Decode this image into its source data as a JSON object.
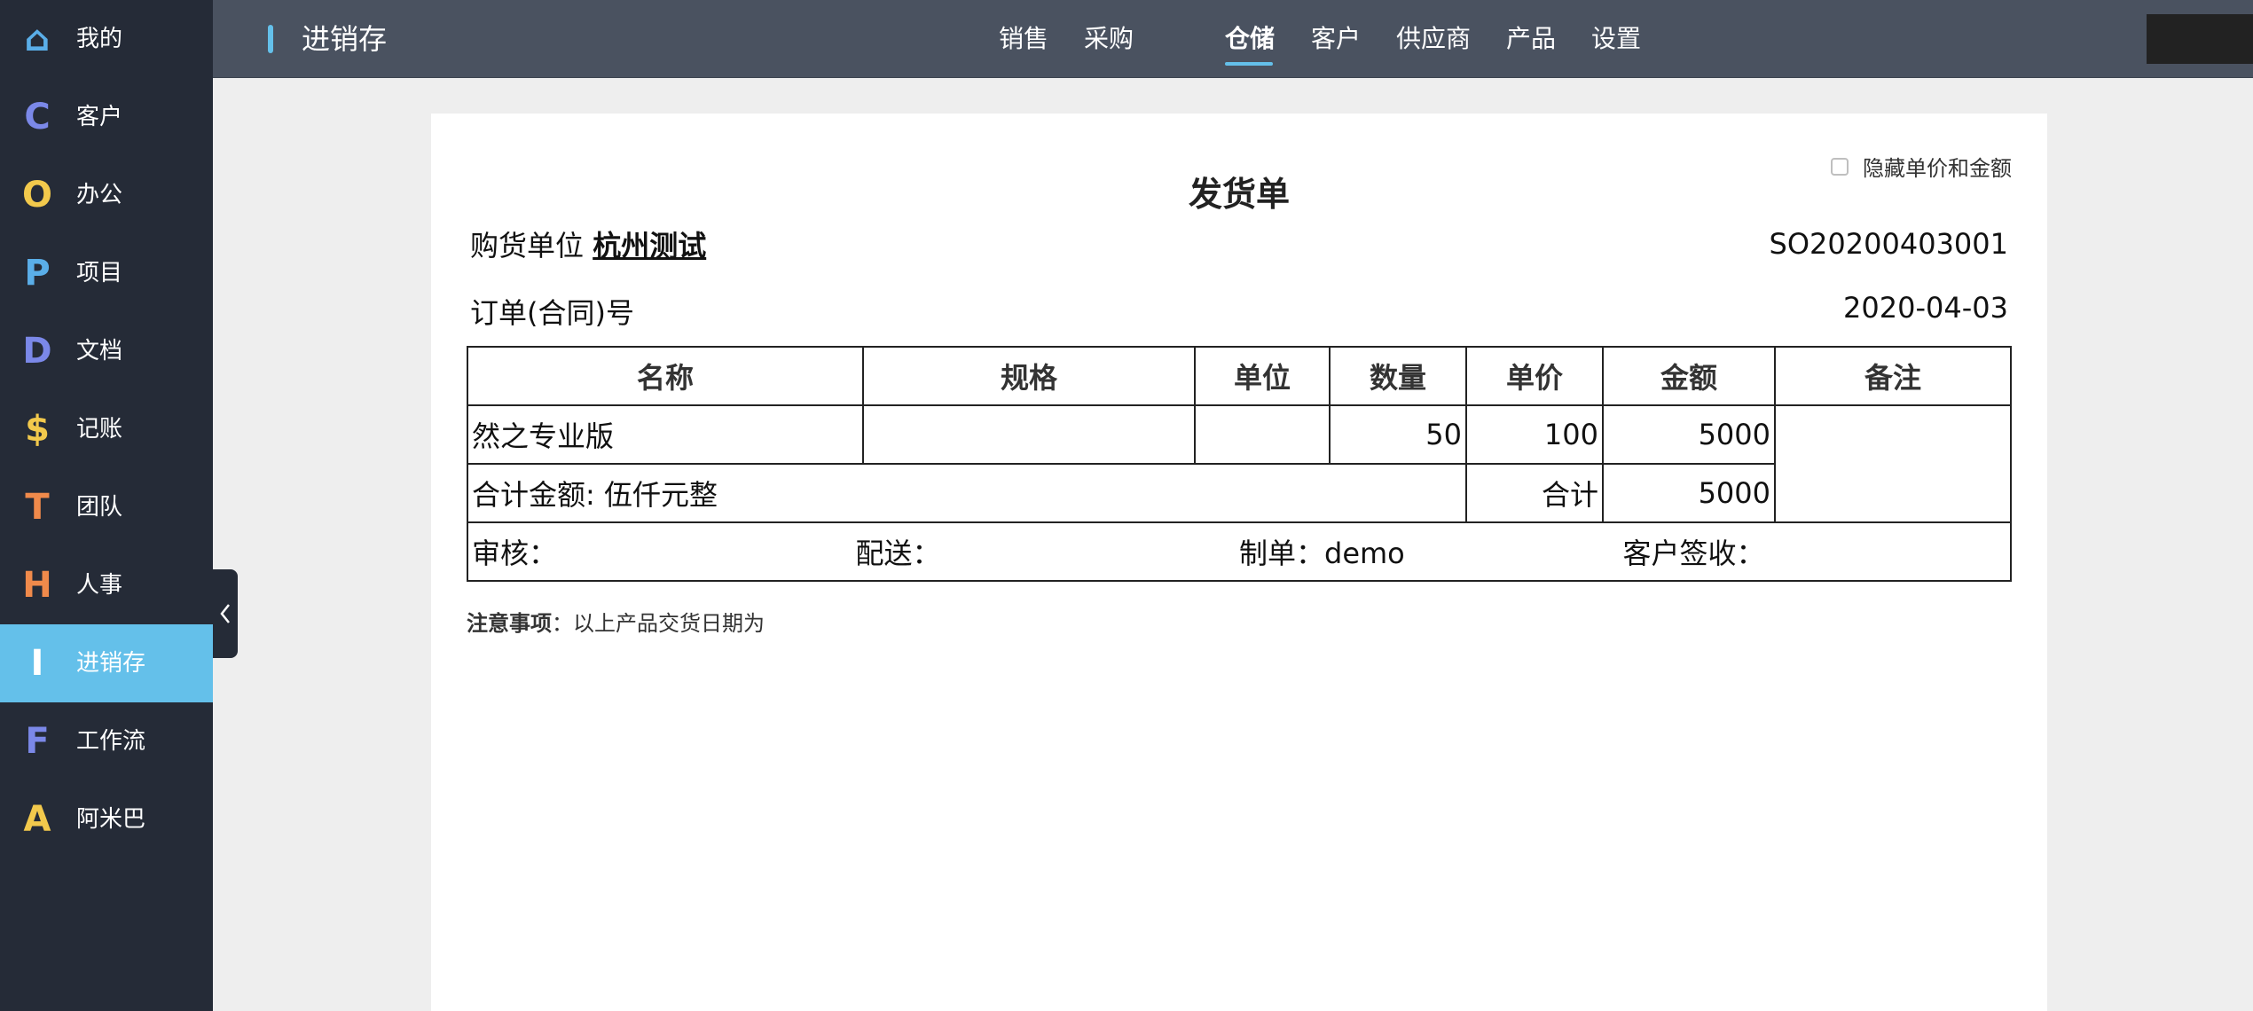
{
  "sidebar": {
    "items": [
      {
        "icon": "home-icon",
        "glyph": "⌂",
        "color": "#5aaee8",
        "label": "我的",
        "active": false
      },
      {
        "icon": "letter-c-icon",
        "glyph": "C",
        "color": "#7b88e8",
        "label": "客户",
        "active": false
      },
      {
        "icon": "letter-o-icon",
        "glyph": "O",
        "color": "#f2c94c",
        "label": "办公",
        "active": false
      },
      {
        "icon": "letter-p-icon",
        "glyph": "P",
        "color": "#5aaee8",
        "label": "项目",
        "active": false
      },
      {
        "icon": "letter-d-icon",
        "glyph": "D",
        "color": "#7b88e8",
        "label": "文档",
        "active": false
      },
      {
        "icon": "dollar-icon",
        "glyph": "$",
        "color": "#f2c94c",
        "label": "记账",
        "active": false
      },
      {
        "icon": "letter-t-icon",
        "glyph": "T",
        "color": "#f08a4b",
        "label": "团队",
        "active": false
      },
      {
        "icon": "letter-h-icon",
        "glyph": "H",
        "color": "#f08a4b",
        "label": "人事",
        "active": false
      },
      {
        "icon": "letter-i-icon",
        "glyph": "I",
        "color": "#ffffff",
        "label": "进销存",
        "active": true
      },
      {
        "icon": "letter-f-icon",
        "glyph": "F",
        "color": "#7b88e8",
        "label": "工作流",
        "active": false
      },
      {
        "icon": "letter-a-icon",
        "glyph": "A",
        "color": "#f2c94c",
        "label": "阿米巴",
        "active": false
      }
    ]
  },
  "header": {
    "app_title": "进销存",
    "tabs": [
      {
        "label": "销售",
        "active": false
      },
      {
        "label": "采购",
        "active": false
      },
      {
        "label": "仓储",
        "active": true
      },
      {
        "label": "客户",
        "active": false
      },
      {
        "label": "供应商",
        "active": false
      },
      {
        "label": "产品",
        "active": false
      },
      {
        "label": "设置",
        "active": false
      }
    ],
    "accent_color": "#64c0ea"
  },
  "document": {
    "title": "发货单",
    "hide_price_label": "隐藏单价和金额",
    "buyer_label": "购货单位",
    "buyer_value": "杭州测试",
    "order_no": "SO20200403001",
    "contract_label": "订单(合同)号",
    "date": "2020-04-03",
    "columns": [
      "名称",
      "规格",
      "单位",
      "数量",
      "单价",
      "金额",
      "备注"
    ],
    "rows": [
      {
        "name": "然之专业版",
        "spec": "",
        "unit": "",
        "qty": "50",
        "price": "100",
        "amount": "5000"
      }
    ],
    "total_label": "合计金额: 伍仟元整",
    "sum_label": "合计",
    "sum_value": "5000",
    "sign": {
      "review": "审核：",
      "delivery": "配送：",
      "maker": "制单：demo",
      "receiver": "客户签收："
    },
    "notice_label": "注意事项",
    "notice_text": "：以上产品交货日期为"
  }
}
